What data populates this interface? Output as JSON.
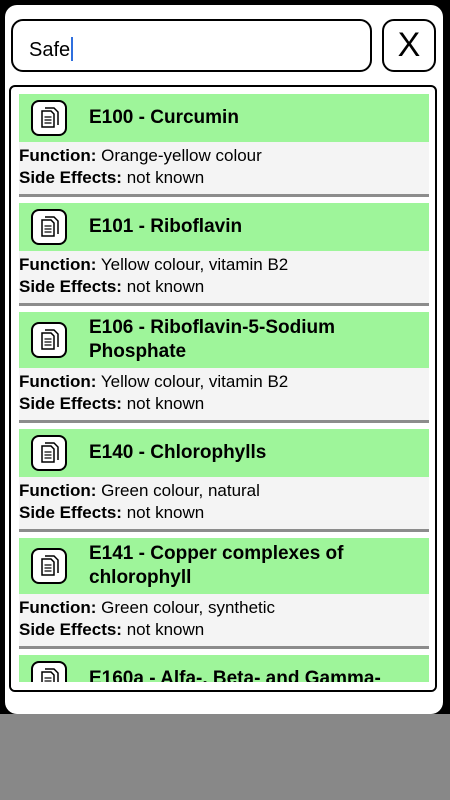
{
  "search": {
    "value": "Safe"
  },
  "close_button": {
    "label": "X"
  },
  "labels": {
    "function": "Function:",
    "side_effects": "Side Effects:"
  },
  "items": [
    {
      "title": "E100 - Curcumin",
      "function": "Orange-yellow colour",
      "side_effects": "not known"
    },
    {
      "title": "E101 - Riboflavin",
      "function": "Yellow colour, vitamin B2",
      "side_effects": "not known"
    },
    {
      "title": "E106 - Riboflavin-5-Sodium Phosphate",
      "function": "Yellow colour, vitamin B2",
      "side_effects": "not known"
    },
    {
      "title": "E140 - Chlorophylls",
      "function": "Green colour, natural",
      "side_effects": "not known"
    },
    {
      "title": "E141 - Copper complexes of chlorophyll",
      "function": "Green colour, synthetic",
      "side_effects": "not known"
    },
    {
      "title": "E160a - Alfa-, Beta- and Gamma-",
      "function": "",
      "side_effects": ""
    }
  ],
  "colors": {
    "header_green": "#9ef59a",
    "row_bg": "#f4f4f4",
    "caret": "#2f6fde",
    "overlay": "#888888"
  },
  "icon": "document-icon"
}
